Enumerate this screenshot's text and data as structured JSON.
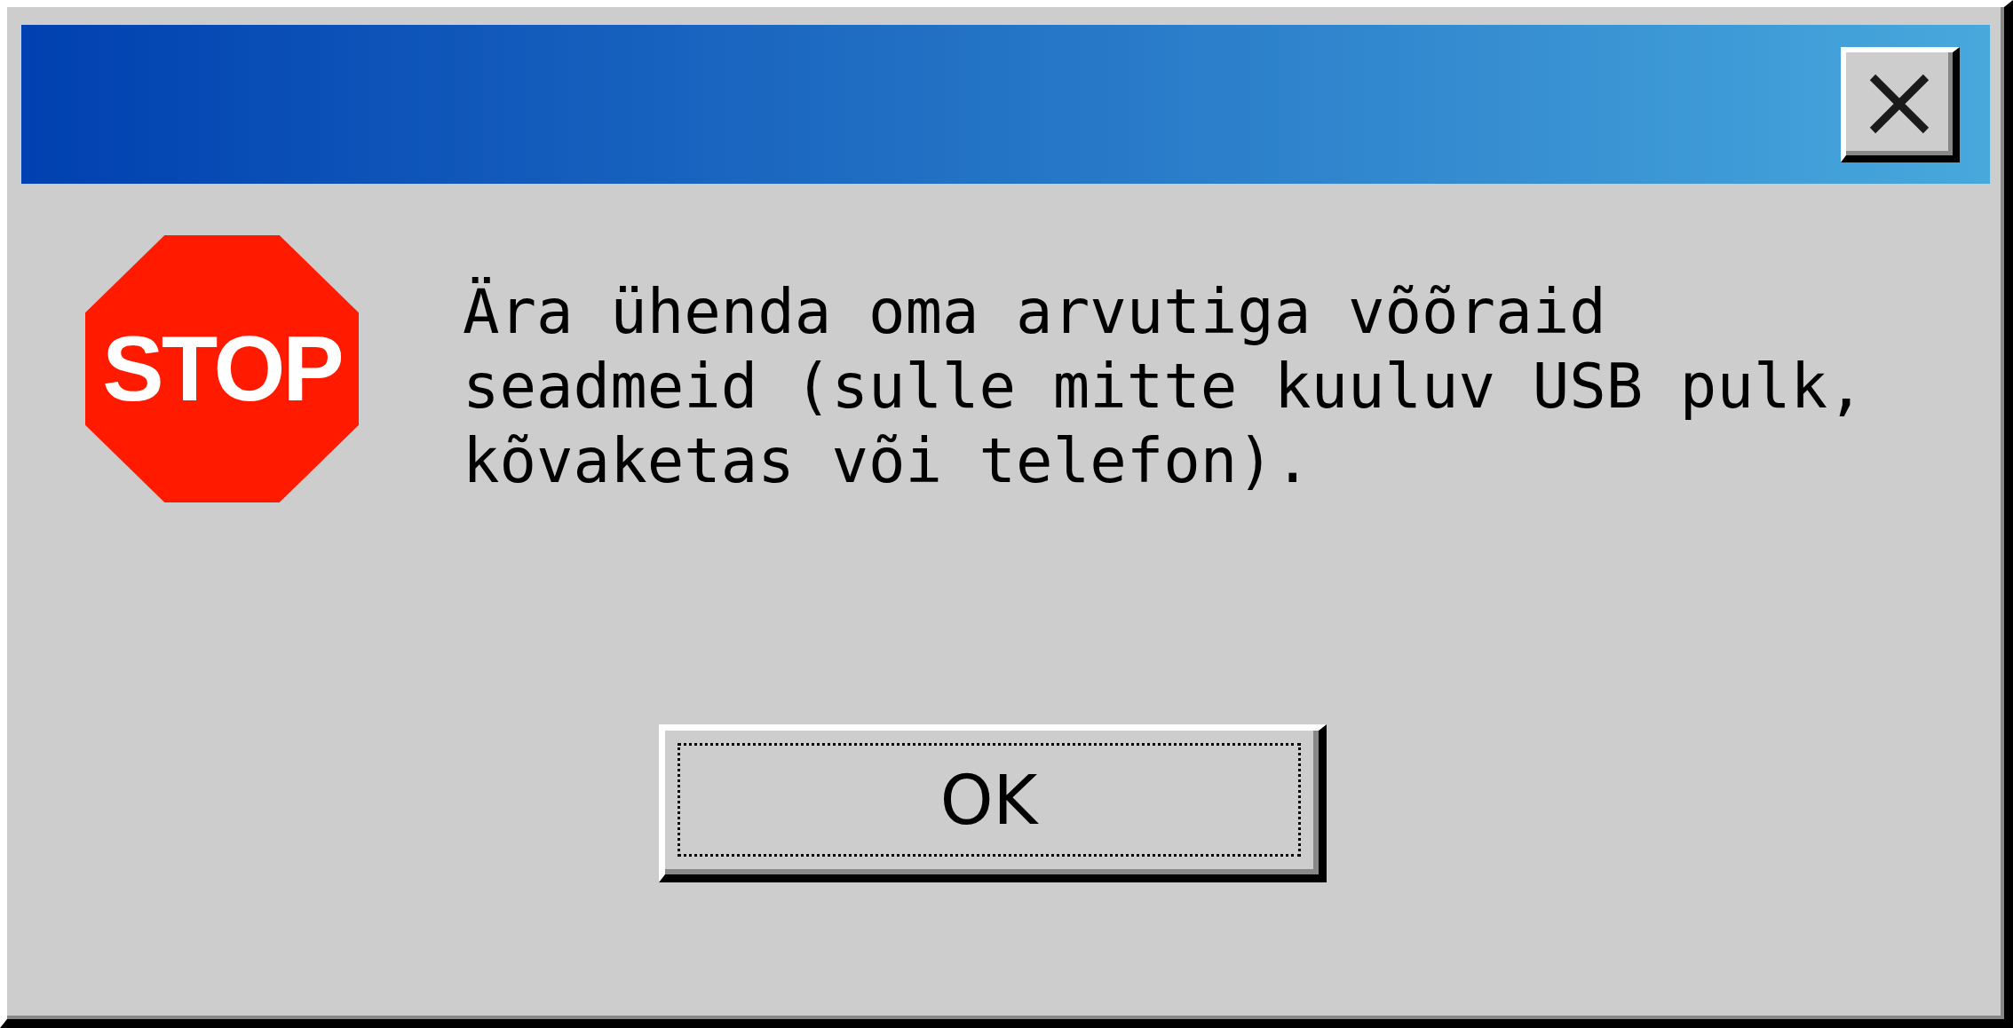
{
  "stop_sign": {
    "label": "STOP"
  },
  "message": "Ära ühenda oma arvutiga võõraid seadmeid (sulle mitte kuuluv USB pulk, kõvaketas või telefon).",
  "buttons": [
    {
      "label": "OK",
      "focused": true
    }
  ]
}
